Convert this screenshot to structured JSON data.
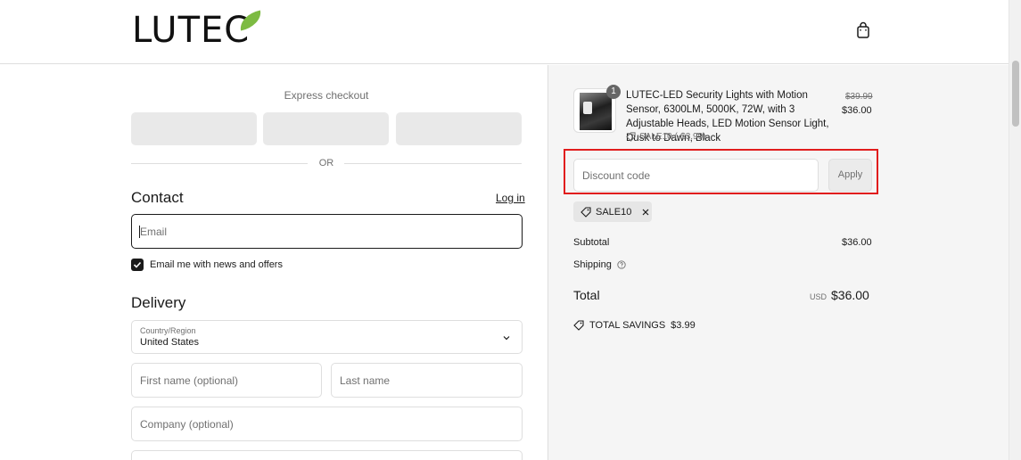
{
  "header": {
    "logo_text": "LUTEC",
    "cart_icon": "shopping-bag-icon"
  },
  "express": {
    "label": "Express checkout",
    "or_label": "OR"
  },
  "contact": {
    "title": "Contact",
    "login_label": "Log in",
    "email_placeholder": "Email",
    "newsletter_label": "Email me with news and offers",
    "newsletter_checked": true
  },
  "delivery": {
    "title": "Delivery",
    "country_label": "Country/Region",
    "country_value": "United States",
    "first_name_placeholder": "First name (optional)",
    "last_name_placeholder": "Last name",
    "company_placeholder": "Company (optional)"
  },
  "summary": {
    "product": {
      "quantity": "1",
      "title": "LUTEC-LED Security Lights with Motion Sensor, 6300LM, 5000K, 72W, with 3 Adjustable Heads, LED Motion Sensor Light, Dusk to Dawn, Black",
      "discount": "SALE10 (-$3.99)",
      "old_price": "$39.99",
      "price": "$36.00"
    },
    "discount_placeholder": "Discount code",
    "apply_label": "Apply",
    "applied_code": "SALE10",
    "subtotal_label": "Subtotal",
    "subtotal_value": "$36.00",
    "shipping_label": "Shipping",
    "total_label": "Total",
    "currency": "USD",
    "total_value": "$36.00",
    "savings_label": "TOTAL SAVINGS",
    "savings_value": "$3.99"
  },
  "colors": {
    "accent_leaf": "#7dbb42",
    "highlight_red": "#e11d1d"
  }
}
